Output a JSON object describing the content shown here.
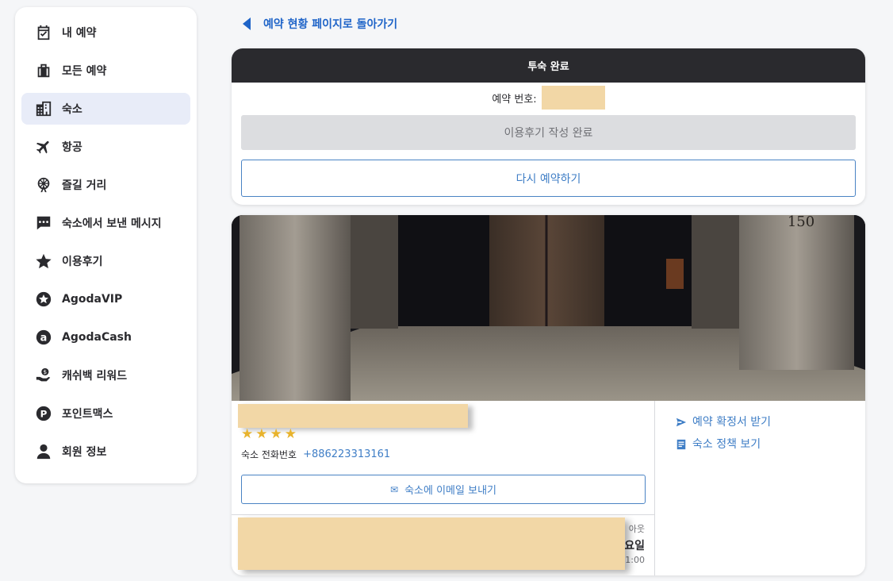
{
  "sidebar": {
    "items": [
      {
        "label": "내 예약",
        "icon": "calendar-check-icon"
      },
      {
        "label": "모든 예약",
        "icon": "luggage-icon"
      },
      {
        "label": "숙소",
        "icon": "buildings-icon",
        "active": true
      },
      {
        "label": "항공",
        "icon": "airplane-icon"
      },
      {
        "label": "즐길 거리",
        "icon": "ferris-wheel-icon"
      },
      {
        "label": "숙소에서 보낸 메시지",
        "icon": "message-icon"
      },
      {
        "label": "이용후기",
        "icon": "star-icon"
      },
      {
        "label": "AgodaVIP",
        "icon": "vip-star-icon"
      },
      {
        "label": "AgodaCash",
        "icon": "agoda-cash-icon"
      },
      {
        "label": "캐쉬백 리워드",
        "icon": "cashback-icon"
      },
      {
        "label": "포인트맥스",
        "icon": "pointsmax-icon"
      },
      {
        "label": "회원 정보",
        "icon": "person-icon"
      }
    ]
  },
  "back_link": {
    "label": "예약 현황 페이지로 돌아가기"
  },
  "status": {
    "title": "투숙 완료",
    "booking_no_label": "예약 번호:",
    "review_label": "이용후기 작성 완료",
    "rebook_label": "다시 예약하기"
  },
  "property": {
    "sign_number": "150",
    "star_count": 4,
    "phone_label": "숙소 전화번호",
    "phone": "+886223313161",
    "email_label": "숙소에 이메일 보내기",
    "checkout_label": "아웃",
    "checkout_day": "요일",
    "checkout_time": "11:00"
  },
  "actions": {
    "confirmation_label": "예약 확정서 받기",
    "policy_label": "숙소 정책 보기"
  },
  "colors": {
    "accent_blue": "#3f7ec6",
    "header_dark": "#2a2a2e",
    "star_yellow": "#e8b32d",
    "redaction": "#f2d7a6"
  }
}
